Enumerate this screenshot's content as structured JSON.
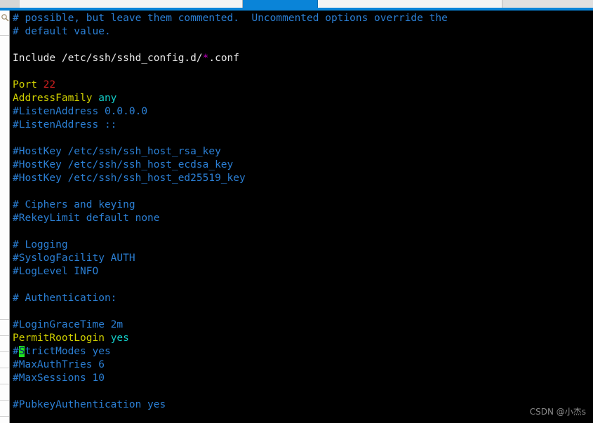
{
  "window": {
    "tabs": [
      {
        "name": "tab-inactive-left",
        "state": "inactive",
        "label": ""
      },
      {
        "name": "tab-first",
        "state": "inactive",
        "label": ""
      },
      {
        "name": "tab-active",
        "state": "active",
        "label": ""
      },
      {
        "name": "tab-third",
        "state": "inactive",
        "label": ""
      },
      {
        "name": "tab-filler",
        "state": "filler",
        "label": ""
      }
    ],
    "accent_color": "#0a84d8"
  },
  "sidebar": {
    "icon": "search-icon",
    "separator_count": 7
  },
  "terminal": {
    "background_color": "#000000",
    "file": "sshd_config",
    "cursor": {
      "row": 25,
      "col": 2,
      "char": "S",
      "color": "#20e020"
    },
    "lines": [
      {
        "id": 1,
        "segments": [
          {
            "text": "# possible, but leave them commented.  Uncommented options override the",
            "cls": "c-comment"
          }
        ]
      },
      {
        "id": 2,
        "segments": [
          {
            "text": "# default value.",
            "cls": "c-comment"
          }
        ]
      },
      {
        "id": 3,
        "segments": []
      },
      {
        "id": 4,
        "segments": [
          {
            "text": "Include /etc/ssh/sshd_config.d/",
            "cls": "c-plain"
          },
          {
            "text": "*",
            "cls": "c-glob"
          },
          {
            "text": ".conf",
            "cls": "c-plain"
          }
        ]
      },
      {
        "id": 5,
        "segments": []
      },
      {
        "id": 6,
        "segments": [
          {
            "text": "Port ",
            "cls": "c-key"
          },
          {
            "text": "22",
            "cls": "c-num"
          }
        ]
      },
      {
        "id": 7,
        "segments": [
          {
            "text": "AddressFamily ",
            "cls": "c-key"
          },
          {
            "text": "any",
            "cls": "c-val"
          }
        ]
      },
      {
        "id": 8,
        "segments": [
          {
            "text": "#ListenAddress 0.0.0.0",
            "cls": "c-comment"
          }
        ]
      },
      {
        "id": 9,
        "segments": [
          {
            "text": "#ListenAddress ::",
            "cls": "c-comment"
          }
        ]
      },
      {
        "id": 10,
        "segments": []
      },
      {
        "id": 11,
        "segments": [
          {
            "text": "#HostKey /etc/ssh/ssh_host_rsa_key",
            "cls": "c-comment"
          }
        ]
      },
      {
        "id": 12,
        "segments": [
          {
            "text": "#HostKey /etc/ssh/ssh_host_ecdsa_key",
            "cls": "c-comment"
          }
        ]
      },
      {
        "id": 13,
        "segments": [
          {
            "text": "#HostKey /etc/ssh/ssh_host_ed25519_key",
            "cls": "c-comment"
          }
        ]
      },
      {
        "id": 14,
        "segments": []
      },
      {
        "id": 15,
        "segments": [
          {
            "text": "# Ciphers and keying",
            "cls": "c-comment"
          }
        ]
      },
      {
        "id": 16,
        "segments": [
          {
            "text": "#RekeyLimit default none",
            "cls": "c-comment"
          }
        ]
      },
      {
        "id": 17,
        "segments": []
      },
      {
        "id": 18,
        "segments": [
          {
            "text": "# Logging",
            "cls": "c-comment"
          }
        ]
      },
      {
        "id": 19,
        "segments": [
          {
            "text": "#SyslogFacility AUTH",
            "cls": "c-comment"
          }
        ]
      },
      {
        "id": 20,
        "segments": [
          {
            "text": "#LogLevel INFO",
            "cls": "c-comment"
          }
        ]
      },
      {
        "id": 21,
        "segments": []
      },
      {
        "id": 22,
        "segments": [
          {
            "text": "# Authentication:",
            "cls": "c-comment"
          }
        ]
      },
      {
        "id": 23,
        "segments": []
      },
      {
        "id": 24,
        "segments": [
          {
            "text": "#LoginGraceTime 2m",
            "cls": "c-comment"
          }
        ]
      },
      {
        "id": 25,
        "segments": [
          {
            "text": "PermitRootLogin ",
            "cls": "c-key"
          },
          {
            "text": "yes",
            "cls": "c-val"
          }
        ]
      },
      {
        "id": 26,
        "segments": [
          {
            "text": "#",
            "cls": "c-comment"
          },
          {
            "text": "S",
            "cls": "c-comment cursor"
          },
          {
            "text": "trictModes yes",
            "cls": "c-comment"
          }
        ]
      },
      {
        "id": 27,
        "segments": [
          {
            "text": "#MaxAuthTries 6",
            "cls": "c-comment"
          }
        ]
      },
      {
        "id": 28,
        "segments": [
          {
            "text": "#MaxSessions 10",
            "cls": "c-comment"
          }
        ]
      },
      {
        "id": 29,
        "segments": []
      },
      {
        "id": 30,
        "segments": [
          {
            "text": "#PubkeyAuthentication yes",
            "cls": "c-comment"
          }
        ]
      }
    ]
  },
  "watermark": {
    "text": "CSDN @小杰s"
  }
}
